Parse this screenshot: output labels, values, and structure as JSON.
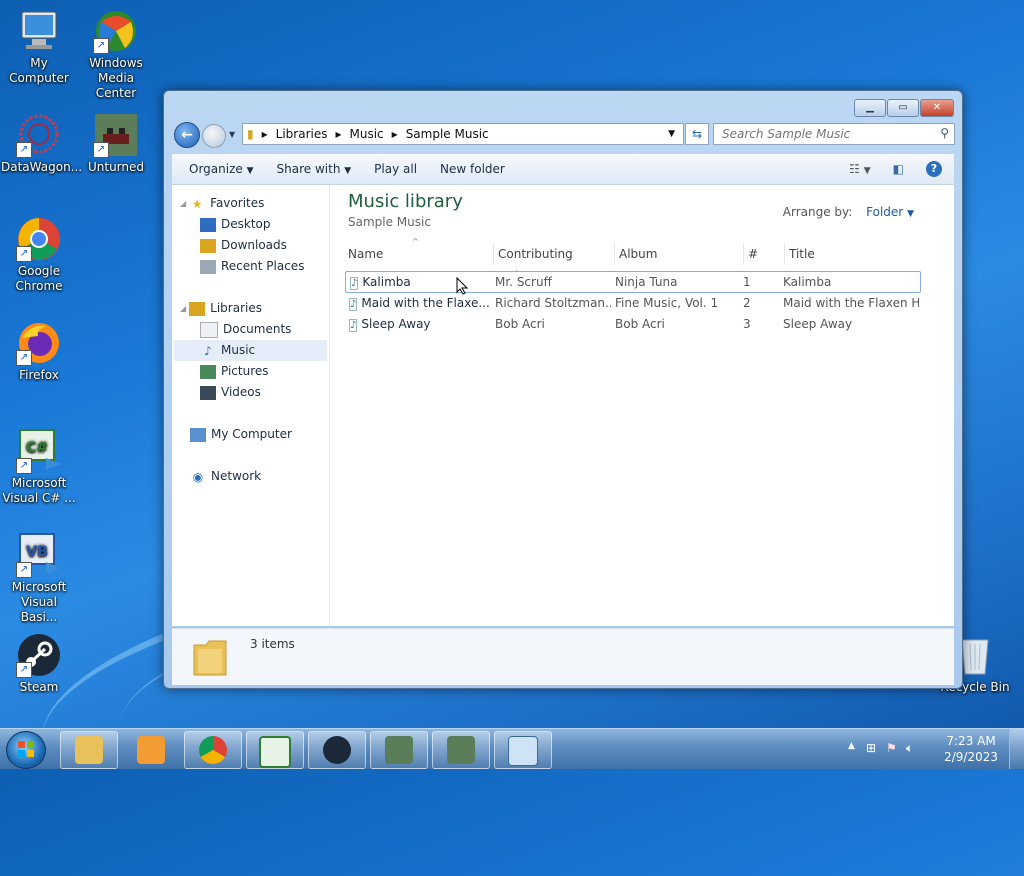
{
  "desktop": {
    "icons": [
      {
        "label": "My Computer",
        "icon": "computer-icon"
      },
      {
        "label": "Windows Media Center",
        "icon": "media-center-icon"
      },
      {
        "label": "DataWagon...",
        "icon": "datawagon-icon"
      },
      {
        "label": "Unturned",
        "icon": "unturned-icon"
      },
      {
        "label": "Google Chrome",
        "icon": "chrome-icon"
      },
      {
        "label": "Firefox",
        "icon": "firefox-icon"
      },
      {
        "label": "Microsoft Visual C# ...",
        "icon": "visual-csharp-icon"
      },
      {
        "label": "Microsoft Visual Basi...",
        "icon": "visual-basic-icon"
      },
      {
        "label": "Steam",
        "icon": "steam-icon"
      },
      {
        "label": "Recycle Bin",
        "icon": "recycle-bin-icon"
      }
    ]
  },
  "window": {
    "breadcrumb": [
      "Libraries",
      "Music",
      "Sample Music"
    ],
    "search_placeholder": "Search Sample Music",
    "toolbar": {
      "organize": "Organize",
      "share_with": "Share with",
      "play_all": "Play all",
      "new_folder": "New folder"
    },
    "nav": {
      "favorites": "Favorites",
      "desktop": "Desktop",
      "downloads": "Downloads",
      "recent_places": "Recent Places",
      "libraries": "Libraries",
      "documents": "Documents",
      "music": "Music",
      "pictures": "Pictures",
      "videos": "Videos",
      "my_computer": "My Computer",
      "network": "Network"
    },
    "library_title": "Music library",
    "library_subtitle": "Sample Music",
    "arrange_by_label": "Arrange by:",
    "arrange_by_value": "Folder",
    "columns": [
      "Name",
      "Contributing artists",
      "Album",
      "#",
      "Title"
    ],
    "rows": [
      {
        "name": "Kalimba",
        "artist": "Mr. Scruff",
        "album": "Ninja Tuna",
        "num": "1",
        "title": "Kalimba"
      },
      {
        "name": "Maid with the Flaxe...",
        "artist": "Richard Stoltzman...",
        "album": "Fine Music, Vol. 1",
        "num": "2",
        "title": "Maid with the Flaxen H..."
      },
      {
        "name": "Sleep Away",
        "artist": "Bob Acri",
        "album": "Bob Acri",
        "num": "3",
        "title": "Sleep Away"
      }
    ],
    "status_items": "3 items"
  },
  "taskbar": {
    "time": "7:23 AM",
    "date": "2/9/2023"
  },
  "colors": {
    "accent_title": "#1e5f3c",
    "selection_border": "#84acdd"
  }
}
